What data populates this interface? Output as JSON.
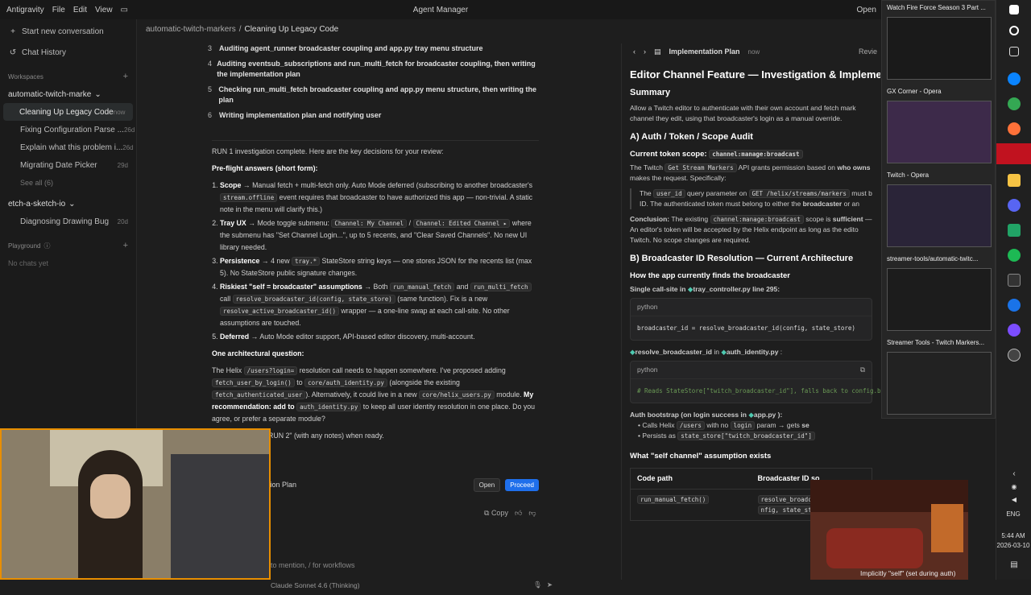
{
  "titlebar": {
    "app": "Antigravity",
    "menu": [
      "File",
      "Edit",
      "View"
    ],
    "center": "Agent Manager",
    "right": "Open"
  },
  "sidebar": {
    "new_conversation": "Start new conversation",
    "chat_history": "Chat History",
    "workspaces_label": "Workspaces",
    "workspace1": "automatic-twitch-marke",
    "items": [
      {
        "label": "Cleaning Up Legacy Code",
        "age": "now"
      },
      {
        "label": "Fixing Configuration Parse ...",
        "age": "26d"
      },
      {
        "label": "Explain what this problem i...",
        "age": "26d"
      },
      {
        "label": "Migrating Date Picker",
        "age": "29d"
      }
    ],
    "see_all": "See all (6)",
    "workspace2": "etch-a-sketch-io",
    "items2": [
      {
        "label": "Diagnosing Drawing Bug",
        "age": "20d"
      }
    ],
    "playground_label": "Playground",
    "no_chats": "No chats yet"
  },
  "breadcrumb": {
    "project": "automatic-twitch-markers",
    "sep": "/",
    "current": "Cleaning Up Legacy Code"
  },
  "steps": [
    {
      "n": "3",
      "text": "Auditing agent_runner broadcaster coupling and app.py tray menu structure"
    },
    {
      "n": "4",
      "text": "Auditing eventsub_subscriptions and run_multi_fetch for broadcaster coupling, then writing the implementation plan"
    },
    {
      "n": "5",
      "text": "Checking run_multi_fetch broadcaster coupling and app.py menu structure, then writing the plan"
    },
    {
      "n": "6",
      "text": "Writing implementation plan and notifying user"
    }
  ],
  "message": {
    "intro": "RUN 1 investigation complete. Here are the key decisions for your review:",
    "preflight": "Pre-flight answers (short form):",
    "scope_b": "Scope",
    "scope_t1": " → Manual fetch + multi-fetch only. Auto Mode deferred (subscribing to another broadcaster's ",
    "scope_code": "stream.offline",
    "scope_t2": " event requires that broadcaster to have authorized this app — non-trivial. A static note in the menu will clarify this.)",
    "tray_b": "Tray UX",
    "tray_t1": " → Mode toggle submenu: ",
    "tray_code1": "Channel: My Channel",
    "tray_sep": " / ",
    "tray_code2": "Channel: Edited Channel ▸",
    "tray_t2": " where the submenu has \"Set Channel Login...\", up to 5 recents, and \"Clear Saved Channels\". No new UI library needed.",
    "pers_b": "Persistence",
    "pers_t1": " → 4 new ",
    "pers_code": "tray.*",
    "pers_t2": " StateStore string keys — one stores JSON for the recents list (max 5). No StateStore public signature changes.",
    "risk_b": "Riskiest \"self = broadcaster\" assumptions",
    "risk_t1": " → Both ",
    "risk_code1": "run_manual_fetch",
    "risk_t2": " and ",
    "risk_code2": "run_multi_fetch",
    "risk_t3": " call ",
    "risk_code3": "resolve_broadcaster_id(config, state_store)",
    "risk_t4": " (same function). Fix is a new ",
    "risk_code4": "resolve_active_broadcaster_id()",
    "risk_t5": " wrapper — a one-line swap at each call-site. No other assumptions are touched.",
    "def_b": "Deferred",
    "def_t": " → Auto Mode editor support, API-based editor discovery, multi-account.",
    "arch_q": "One architectural question:",
    "arch_t1": "The Helix ",
    "arch_code1": "/users?login=",
    "arch_t2": " resolution call needs to happen somewhere. I've proposed adding ",
    "arch_code2": "fetch_user_by_login()",
    "arch_t3": " to ",
    "arch_code3": "core/auth_identity.py",
    "arch_t4": " (alongside the existing ",
    "arch_code4": "fetch_authenticated_user",
    "arch_t5": "). Alternatively, it could live in a new ",
    "arch_code5": "core/helix_users.py",
    "arch_t6": " module. ",
    "arch_b": "My recommendation: add to ",
    "arch_code6": "auth_identity.py",
    "arch_t7": " to keep all user identity resolution in one place. Do you agree, or prefer a separate module?",
    "run2": "RUN 2\" (with any notes) when ready."
  },
  "runbar": {
    "label": "ution Plan",
    "open": "Open",
    "proceed": "Proceed"
  },
  "copy": "Copy",
  "input": {
    "placeholder": "to mention, / for workflows",
    "model": "Claude Sonnet 4.6 (Thinking)"
  },
  "plan": {
    "tab": "Implementation Plan",
    "tab_age": "now",
    "review": "Revie",
    "title": "Editor Channel Feature — Investigation & Implemen",
    "summary_h": "Summary",
    "summary_1": "Allow a Twitch editor to authenticate with their own account and fetch mark",
    "summary_2": "channel they edit, using that broadcaster's login as a manual override.",
    "a_h": "A) Auth / Token / Scope Audit",
    "cur_scope_label": "Current token scope:",
    "cur_scope_code": "channel:manage:broadcast",
    "a_t1": "The Twitch ",
    "a_code1": "Get Stream Markers",
    "a_t2": " API grants permission based on ",
    "a_b1": "who owns",
    "a_t3": "makes the request. Specifically:",
    "q_t1": "The ",
    "q_code1": "user_id",
    "q_t2": " query parameter on ",
    "q_code2": "GET /helix/streams/markers",
    "q_t3": " must b",
    "q_t4": "ID. The authenticated token must belong to either the ",
    "q_b": "broadcaster",
    "q_t5": " or an",
    "concl_b": "Conclusion:",
    "concl_t1": " The existing ",
    "concl_code": "channel:manage:broadcast",
    "concl_t2": " scope is ",
    "concl_b2": "sufficient",
    "concl_t3": " —",
    "concl_t4": "An editor's token will be accepted by the Helix endpoint as long as the edito",
    "concl_t5": "Twitch. No scope changes are required.",
    "b_h": "B) Broadcaster ID Resolution — Current Architecture",
    "how_h": "How the app currently finds the broadcaster",
    "single_b": "Single call-site in ",
    "single_file": "tray_controller.py",
    "single_line": " line 295:",
    "lang1": "python",
    "code1": "broadcaster_id = resolve_broadcaster_id(config, state_store)",
    "resolve_b": "resolve_broadcaster_id",
    "resolve_in": " in ",
    "resolve_file": "auth_identity.py",
    "resolve_colon": " :",
    "lang2": "python",
    "code2": "# Reads StateStore[\"twitch_broadcaster_id\"], falls back to config.broadcaster_id",
    "boot_b": "Auth bootstrap (on login success in ",
    "boot_file": "app.py",
    "boot_end": " ):",
    "boot_1a": "Calls Helix ",
    "boot_1code": "/users",
    "boot_1b": " with no ",
    "boot_1code2": "login",
    "boot_1c": " param → gets ",
    "boot_1d": "se",
    "boot_2a": "Persists as ",
    "boot_2code": "state_store[\"twitch_broadcaster_id\"]",
    "self_h": "What \"self channel\" assumption exists",
    "tbl_h1": "Code path",
    "tbl_h2": "Broadcaster ID so",
    "tbl_r1": "run_manual_fetch()",
    "tbl_r2": "resolve_broadcaster_id(co",
    "tbl_r3": "nfig, state_store)",
    "tbl_caption": "Implicitly \"self\" (set during auth)"
  },
  "popup": [
    {
      "title": "Watch Fire Force Season 3 Part ..."
    },
    {
      "title": "GX Corner - Opera"
    },
    {
      "title": "Twitch - Opera"
    },
    {
      "title": "streamer-tools/automatic-twitc..."
    },
    {
      "title": "Streamer Tools - Twitch Markers..."
    }
  ],
  "system": {
    "lang": "ENG",
    "time": "5:44 AM",
    "date": "2026-03-10"
  }
}
